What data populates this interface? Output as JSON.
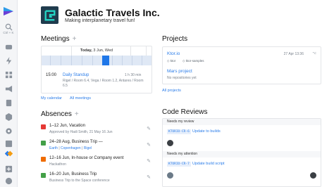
{
  "rail": {
    "search_label": "Ctrl + K"
  },
  "header": {
    "title": "Galactic Travels Inc.",
    "subtitle": "Making interplanetary travel fun!"
  },
  "meetings": {
    "section_title": "Meetings",
    "date_prefix": "Today,",
    "date_rest": " 3 Jun, Wed",
    "event": {
      "time": "15:00",
      "name": "Daily Standup",
      "duration": "1 h 30 min",
      "location": "Rigel / Room 6.4, Vega / Room 1.2, Antares / Room 6.5"
    },
    "links": {
      "my_calendar": "My calendar",
      "all_meetings": "All meetings"
    }
  },
  "absences": {
    "section_title": "Absences",
    "items": [
      {
        "main": "1–12 Jun, Vacation",
        "sub": "Approved by Hadi Smith, 21 May 16 Jun",
        "color": "#e53935"
      },
      {
        "main": "24–28 Aug, Business Trip —",
        "sub_links": [
          "Earth",
          "Copenhagen",
          "Rigel"
        ],
        "color": "#43a047"
      },
      {
        "main": "12–16 Jun, In-house or Company event",
        "sub": "Hackathon",
        "color": "#ef6c00"
      },
      {
        "main": "16–20 Jun, Business Trip",
        "sub": "Business Trip to the Space conference",
        "color": "#43a047"
      }
    ]
  },
  "projects": {
    "section_title": "Projects",
    "items": [
      {
        "name": "Ktor.io",
        "date": "27 Apr 13:36",
        "tags": [
          "ktor",
          "ktor-samples"
        ]
      },
      {
        "name": "Mars project",
        "sub": "No repositories yet"
      }
    ],
    "all_link": "All projects"
  },
  "code_reviews": {
    "section_title": "Code Reviews",
    "groups": [
      {
        "label": "Needs my review",
        "items": [
          {
            "code": "KTORIO-CR-6",
            "title": "Update to builds"
          }
        ]
      },
      {
        "label": "Needs my attention",
        "items": [
          {
            "code": "KTORIO-CR-7",
            "title": "Update build script"
          }
        ]
      }
    ]
  },
  "colors": {
    "accent": "#2b7de9",
    "timeline_band": "#dfe8f5",
    "meeting_block": "#1f77e8"
  }
}
